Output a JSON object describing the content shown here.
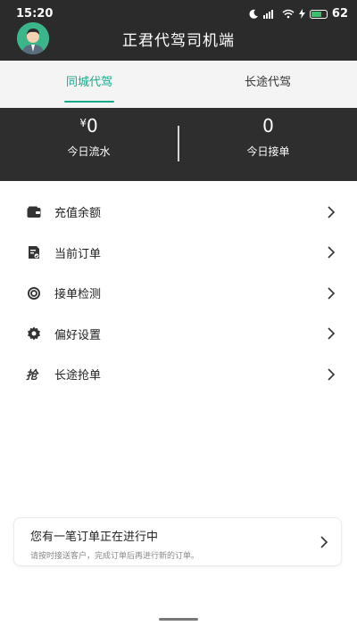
{
  "status_bar": {
    "time": "15:20",
    "signal_text": "4G",
    "battery": "62"
  },
  "header": {
    "title": "正君代驾司机端"
  },
  "tabs": [
    {
      "label": "同城代驾",
      "active": true
    },
    {
      "label": "长途代驾",
      "active": false
    }
  ],
  "stats": {
    "flow": {
      "currency": "¥",
      "value": "0",
      "label": "今日流水"
    },
    "orders": {
      "value": "0",
      "label": "今日接单"
    }
  },
  "menu": [
    {
      "label": "充值余额",
      "icon": "wallet-icon"
    },
    {
      "label": "当前订单",
      "icon": "order-doc-icon"
    },
    {
      "label": "接单检测",
      "icon": "detect-icon"
    },
    {
      "label": "偏好设置",
      "icon": "gear-icon"
    },
    {
      "label": "长途抢单",
      "icon": "grab-order-icon"
    }
  ],
  "order_card": {
    "title": "您有一笔订单正在进行中",
    "subtitle": "请按时接送客户，完成订单后再进行新的订单。"
  },
  "colors": {
    "accent": "#18a98b",
    "dark": "#2b2b2b"
  }
}
